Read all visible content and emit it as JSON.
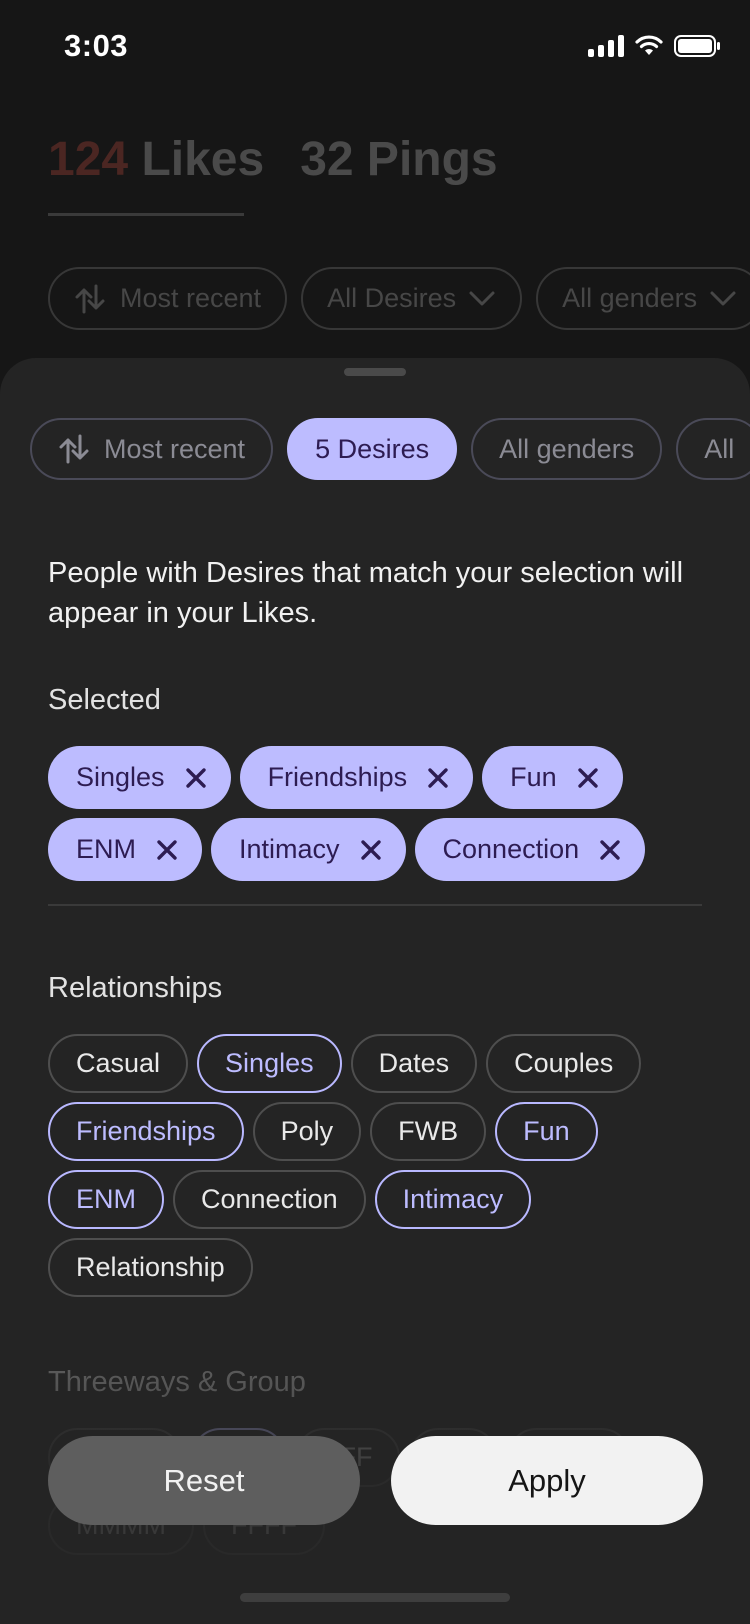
{
  "status_bar": {
    "time": "3:03"
  },
  "background": {
    "tabs": [
      {
        "count": "124",
        "label": "Likes"
      },
      {
        "count": "32",
        "label": "Pings"
      }
    ],
    "filters": [
      "Most recent",
      "All Desires",
      "All genders"
    ]
  },
  "sheet": {
    "filters": [
      "Most recent",
      "5 Desires",
      "All genders",
      "All"
    ],
    "intro": "People with Desires that match your selection will appear in your Likes.",
    "selected_title": "Selected",
    "selected": [
      "Singles",
      "Friendships",
      "Fun",
      "ENM",
      "Intimacy",
      "Connection"
    ],
    "relationships_title": "Relationships",
    "relationships": [
      {
        "label": "Casual",
        "on": false
      },
      {
        "label": "Singles",
        "on": true
      },
      {
        "label": "Dates",
        "on": false
      },
      {
        "label": "Couples",
        "on": false
      },
      {
        "label": "Friendships",
        "on": true
      },
      {
        "label": "Poly",
        "on": false
      },
      {
        "label": "FWB",
        "on": false
      },
      {
        "label": "Fun",
        "on": true
      },
      {
        "label": "ENM",
        "on": true
      },
      {
        "label": "Connection",
        "on": false
      },
      {
        "label": "Intimacy",
        "on": true
      },
      {
        "label": "Relationship",
        "on": false
      }
    ],
    "threeways_title": "Threeways & Group",
    "threeways": [
      {
        "label": "MFMF",
        "on": false
      },
      {
        "label": "MF",
        "on": true
      },
      {
        "label": "FFF",
        "on": false
      },
      {
        "label": "FF",
        "on": false
      },
      {
        "label": "MMM",
        "on": false
      },
      {
        "label": "MMMM",
        "on": false
      },
      {
        "label": "FFFF",
        "on": false
      }
    ],
    "reset_label": "Reset",
    "apply_label": "Apply"
  },
  "colors": {
    "accent": "#bdbcff",
    "accent_text": "#2d1c52",
    "sheet_bg": "#242424"
  }
}
